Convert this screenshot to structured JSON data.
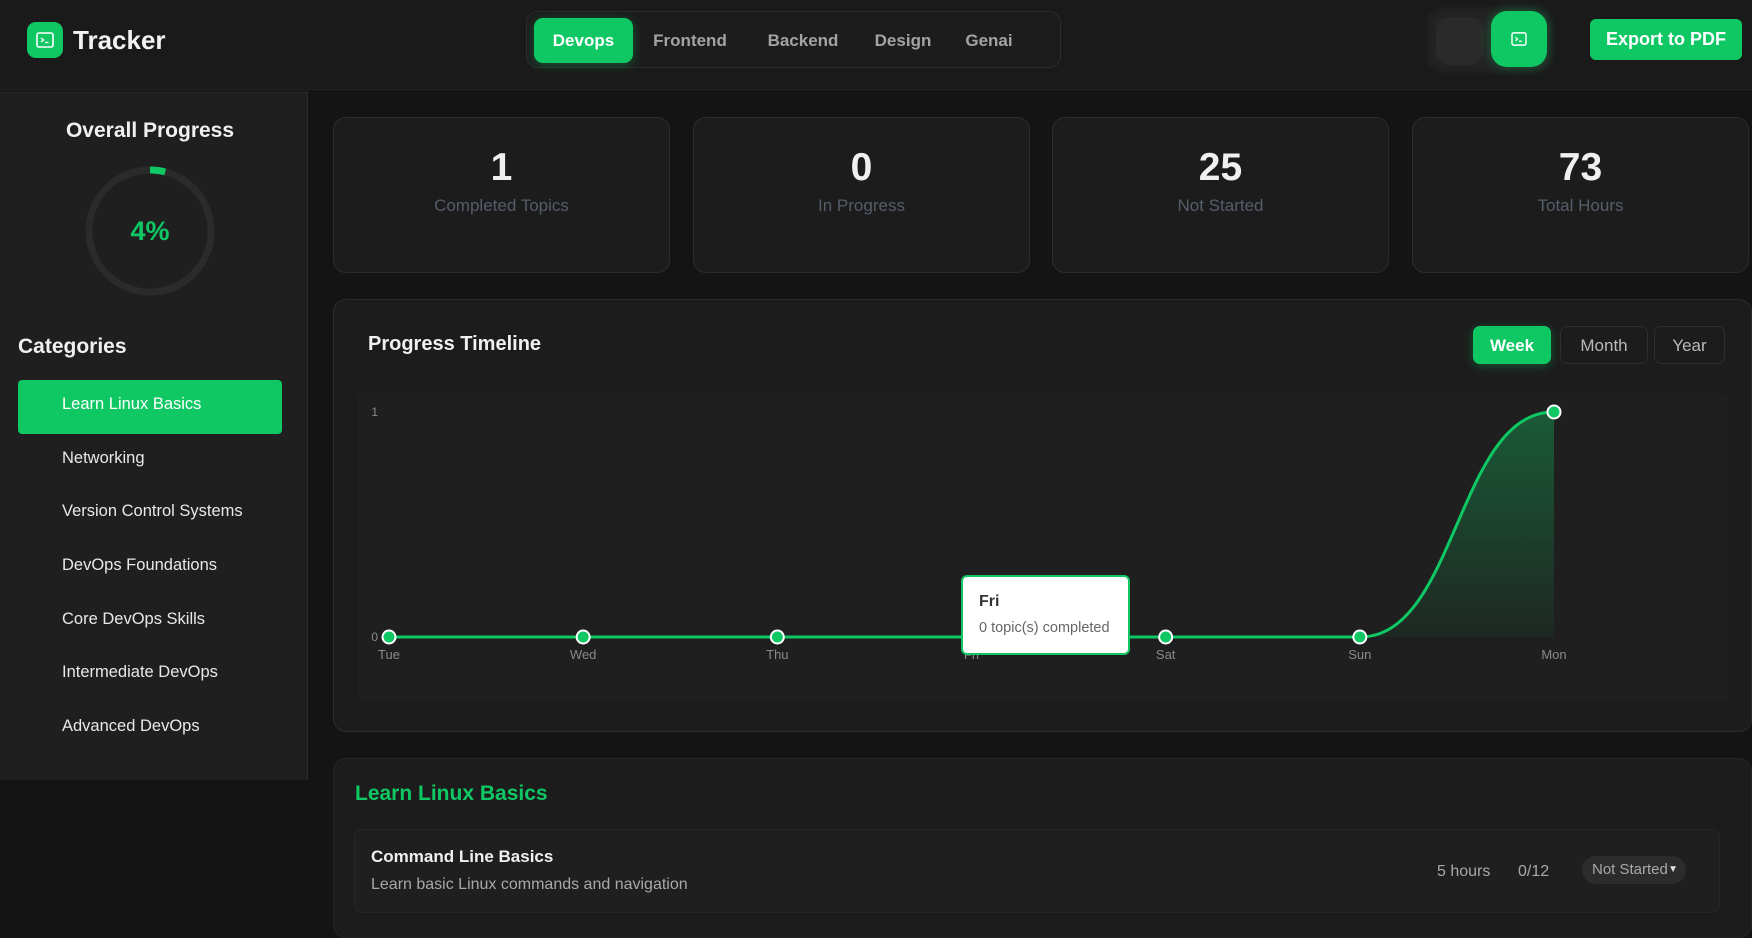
{
  "app": {
    "title": "Tracker"
  },
  "tabs": [
    {
      "label": "Devops",
      "active": true
    },
    {
      "label": "Frontend"
    },
    {
      "label": "Backend"
    },
    {
      "label": "Design"
    },
    {
      "label": "Genai"
    }
  ],
  "header": {
    "export_label": "Export to PDF"
  },
  "sidebar": {
    "progress_title": "Overall Progress",
    "progress_percent": "4%",
    "progress_value": 0.04,
    "categories_title": "Categories",
    "categories": [
      {
        "label": "Learn Linux Basics",
        "active": true
      },
      {
        "label": "Networking"
      },
      {
        "label": "Version Control Systems"
      },
      {
        "label": "DevOps Foundations"
      },
      {
        "label": "Core DevOps Skills"
      },
      {
        "label": "Intermediate DevOps"
      },
      {
        "label": "Advanced DevOps"
      }
    ]
  },
  "stats": [
    {
      "value": "1",
      "label": "Completed Topics"
    },
    {
      "value": "0",
      "label": "In Progress"
    },
    {
      "value": "25",
      "label": "Not Started"
    },
    {
      "value": "73",
      "label": "Total Hours"
    }
  ],
  "timeline": {
    "title": "Progress Timeline",
    "ranges": [
      "Week",
      "Month",
      "Year"
    ],
    "active_range": "Week",
    "tooltip": {
      "title": "Fri",
      "text": "0 topic(s) completed"
    }
  },
  "chart_data": {
    "type": "area",
    "categories": [
      "Tue",
      "Wed",
      "Thu",
      "Fri",
      "Sat",
      "Sun",
      "Mon"
    ],
    "values": [
      0,
      0,
      0,
      0,
      0,
      0,
      1
    ],
    "ylim": [
      0,
      1
    ],
    "yticks": [
      0,
      1
    ],
    "grid": false,
    "color": "#0fc864"
  },
  "section": {
    "title": "Learn Linux Basics",
    "topics": [
      {
        "name": "Command Line Basics",
        "description": "Learn basic Linux commands and navigation",
        "hours": "5 hours",
        "progress": "0/12",
        "status": "Not Started"
      }
    ]
  }
}
